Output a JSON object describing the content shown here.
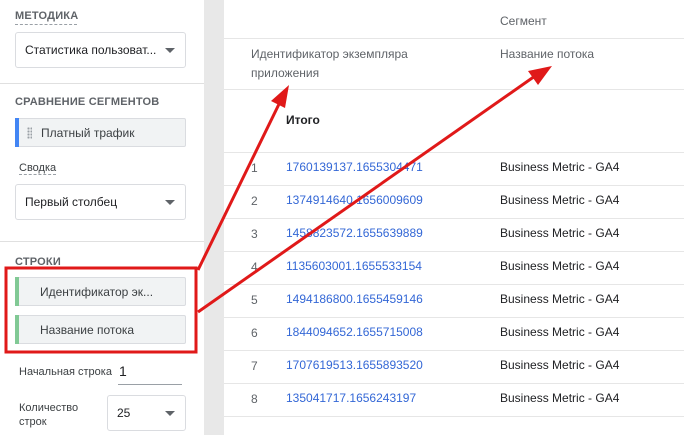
{
  "left": {
    "technique": {
      "title": "МЕТОДИКА",
      "value": "Статистика пользоват..."
    },
    "segments": {
      "title": "СРАВНЕНИЕ СЕГМЕНТОВ",
      "chip": "Платный трафик"
    },
    "summary": {
      "label": "Сводка",
      "value": "Первый столбец"
    },
    "rows": {
      "title": "СТРОКИ",
      "chips": [
        "Идентификатор эк...",
        "Название потока"
      ],
      "start_label": "Начальная строка",
      "start_value": "1",
      "count_label_1": "Количество",
      "count_label_2": "строк",
      "count_value": "25"
    }
  },
  "table": {
    "segment_header": "Сегмент",
    "col1_line1": "Идентификатор экземпляра",
    "col1_line2": "приложения",
    "col2": "Название потока",
    "total_label": "Итого",
    "rows": [
      {
        "n": "1",
        "id": "1760139137.1655304471",
        "stream": "Business Metric - GA4"
      },
      {
        "n": "2",
        "id": "1374914640.1656009609",
        "stream": "Business Metric - GA4"
      },
      {
        "n": "3",
        "id": "1458823572.1655639889",
        "stream": "Business Metric - GA4"
      },
      {
        "n": "4",
        "id": "1135603001.1655533154",
        "stream": "Business Metric - GA4"
      },
      {
        "n": "5",
        "id": "1494186800.1655459146",
        "stream": "Business Metric - GA4"
      },
      {
        "n": "6",
        "id": "1844094652.1655715008",
        "stream": "Business Metric - GA4"
      },
      {
        "n": "7",
        "id": "1707619513.1655893520",
        "stream": "Business Metric - GA4"
      },
      {
        "n": "8",
        "id": "135041717.1656243197",
        "stream": "Business Metric - GA4"
      }
    ]
  },
  "colors": {
    "accent_green": "#81c995",
    "annotation_red": "#e01919",
    "link_blue": "#3367d6"
  },
  "icons": [
    "dropdown-caret-icon",
    "drag-handle-icon"
  ]
}
